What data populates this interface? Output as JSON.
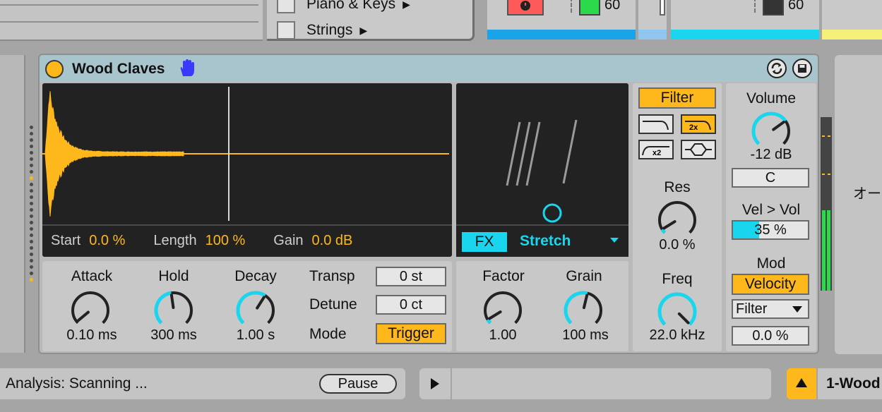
{
  "browser": {
    "items": [
      {
        "label": "Piano & Keys"
      },
      {
        "label": "Strings"
      }
    ]
  },
  "tracks": {
    "left_volume": "60",
    "right_volume": "60",
    "colors": {
      "track1": "#1aa3e8",
      "track2": "#8fc6ee",
      "track3": "#19d5ee",
      "track4": "#f5f07a"
    }
  },
  "device": {
    "title": "Wood Claves",
    "waveform": {
      "start_label": "Start",
      "start_value": "0.0 %",
      "length_label": "Length",
      "length_value": "100 %",
      "gain_label": "Gain",
      "gain_value": "0.0 dB"
    },
    "fx": {
      "button": "FX",
      "type": "Stretch"
    },
    "envelope": {
      "attack_label": "Attack",
      "attack_value": "0.10 ms",
      "hold_label": "Hold",
      "hold_value": "300 ms",
      "decay_label": "Decay",
      "decay_value": "1.00 s"
    },
    "pitch": {
      "transp_label": "Transp",
      "transp_value": "0 st",
      "detune_label": "Detune",
      "detune_value": "0 ct",
      "mode_label": "Mode",
      "mode_value": "Trigger"
    },
    "stretch": {
      "factor_label": "Factor",
      "factor_value": "1.00",
      "grain_label": "Grain",
      "grain_value": "100 ms"
    },
    "filter": {
      "button": "Filter",
      "res_label": "Res",
      "res_value": "0.0 %",
      "freq_label": "Freq",
      "freq_value": "22.0 kHz"
    },
    "output": {
      "volume_label": "Volume",
      "volume_value": "-12 dB",
      "pan_value": "C",
      "vel_vol_label": "Vel > Vol",
      "vel_vol_value": "35 %",
      "vel_vol_fraction": 0.35,
      "mod_label": "Mod",
      "mod_source": "Velocity",
      "mod_target": "Filter",
      "mod_amount": "0.0 %"
    },
    "accent_orange": "#ffb81c",
    "accent_cyan": "#19d5ee"
  },
  "right_panel_text": "オー",
  "status": {
    "text": "Analysis: Scanning ...",
    "pause_label": "Pause"
  },
  "track_name": "1-Wood"
}
